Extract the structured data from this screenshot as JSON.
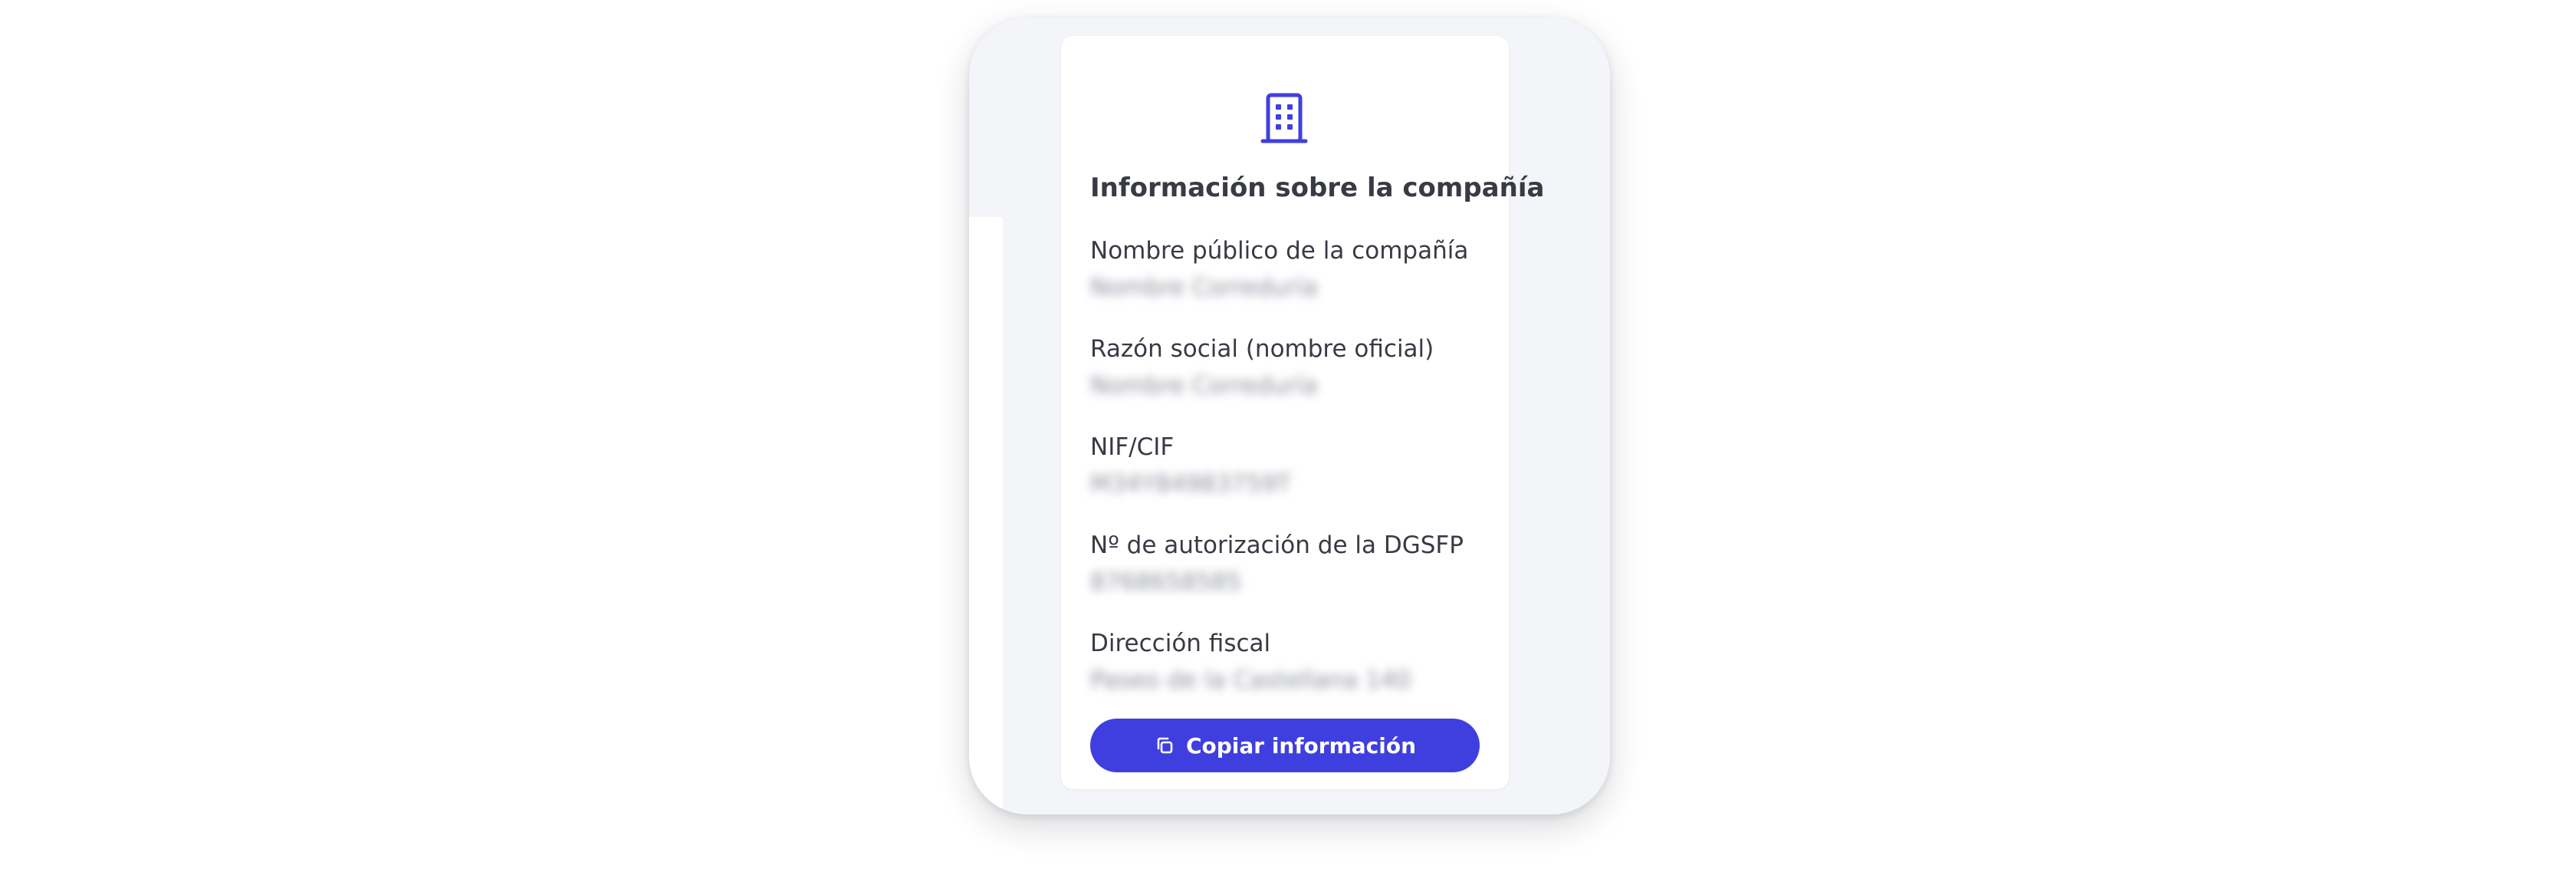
{
  "card": {
    "title": "Información sobre la compañía",
    "icon": "building-icon",
    "accent_color": "#3f3fe0",
    "fields": [
      {
        "label": "Nombre público de la compañía",
        "value": "Nombre Correduría"
      },
      {
        "label": "Razón social (nombre oficial)",
        "value": "Nombre Correduría"
      },
      {
        "label": "NIF/CIF",
        "value": "M34Y84983759T"
      },
      {
        "label": "Nº de autorización de la DGSFP",
        "value": "8768658585"
      },
      {
        "label": "Dirección fiscal",
        "value": "Paseo de la Castellana 140"
      }
    ],
    "copy_button": {
      "icon": "copy-icon",
      "label": "Copiar información"
    }
  }
}
